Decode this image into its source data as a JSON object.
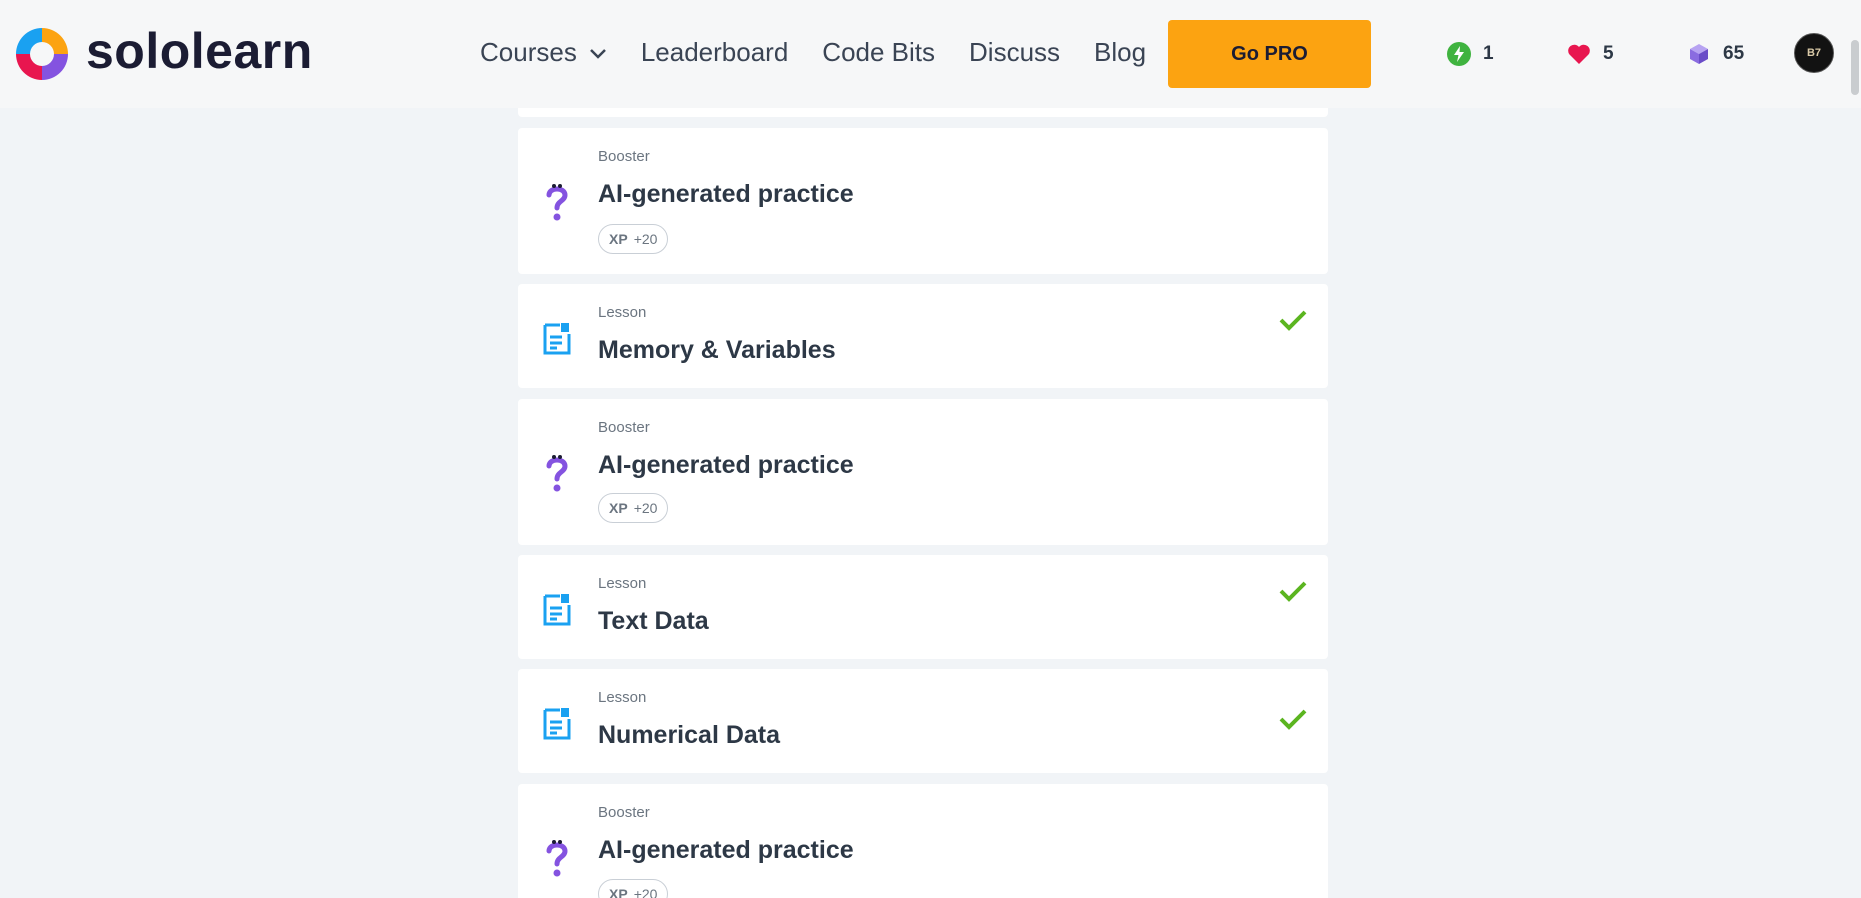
{
  "header": {
    "brand": "sololearn",
    "nav": [
      {
        "label": "Courses"
      },
      {
        "label": "Leaderboard"
      },
      {
        "label": "Code Bits"
      },
      {
        "label": "Discuss"
      },
      {
        "label": "Blog"
      }
    ],
    "go_pro_label": "Go PRO",
    "streak": "1",
    "hearts": "5",
    "gems": "65",
    "avatar_text": "B7"
  },
  "list": {
    "items": [
      {
        "type": "Booster",
        "title": "AI-generated practice",
        "xp_label": "XP",
        "xp_value": "+20",
        "completed": false
      },
      {
        "type": "Lesson",
        "title": "Memory & Variables",
        "completed": true
      },
      {
        "type": "Booster",
        "title": "AI-generated practice",
        "xp_label": "XP",
        "xp_value": "+20",
        "completed": false
      },
      {
        "type": "Lesson",
        "title": "Text Data",
        "completed": true
      },
      {
        "type": "Lesson",
        "title": "Numerical Data",
        "completed": true
      },
      {
        "type": "Booster",
        "title": "AI-generated practice",
        "xp_label": "XP",
        "xp_value": "+20",
        "completed": false
      }
    ]
  },
  "colors": {
    "accent_pro": "#fca311",
    "check_green": "#5bb520",
    "lesson_icon": "#1aa1f1",
    "booster_icon": "#8453e0",
    "heart": "#e8164f",
    "streak_green": "#3fb33f",
    "gem_purple": "#8a6ce0"
  },
  "icons": {
    "booster": "question-mark-icon",
    "lesson": "document-icon",
    "done": "checkmark-icon"
  }
}
